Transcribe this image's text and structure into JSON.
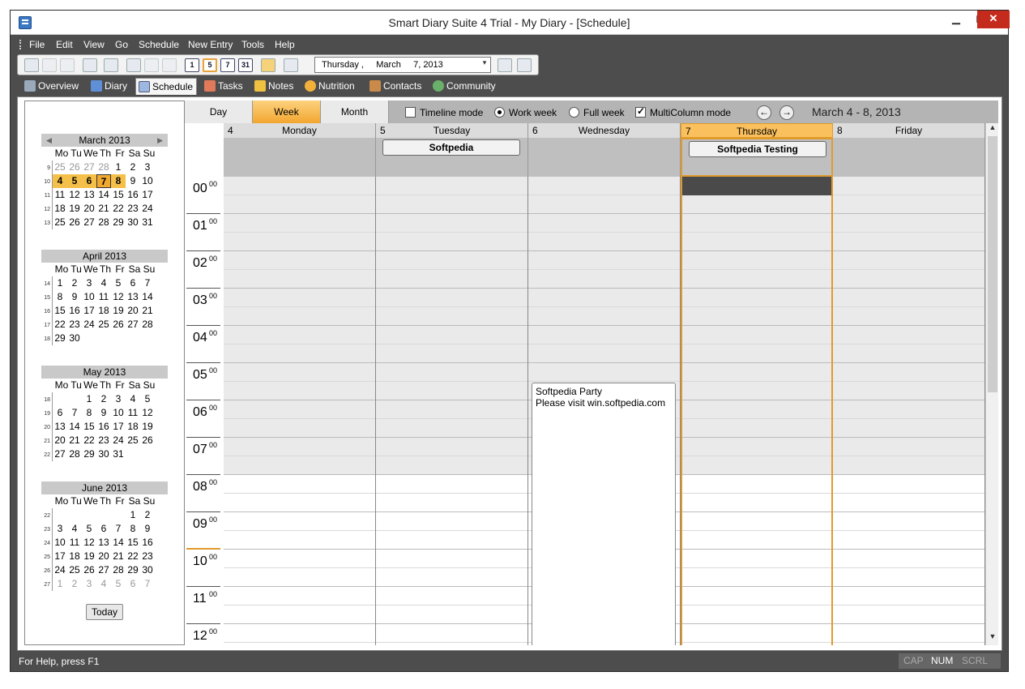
{
  "window": {
    "title": "Smart Diary Suite 4 Trial - My Diary - [Schedule]",
    "min": "▁",
    "max": "▢",
    "close": "✕"
  },
  "menu": [
    "File",
    "Edit",
    "View",
    "Go",
    "Schedule",
    "New Entry",
    "Tools",
    "Help"
  ],
  "toolbar": {
    "cal_buttons": [
      "1",
      "5",
      "7",
      "31"
    ],
    "date_text": "Thursday ,     March     7, 2013",
    "date_drop": "▾"
  },
  "tabs": [
    "Overview",
    "Diary",
    "Schedule",
    "Tasks",
    "Notes",
    "Nutrition",
    "Contacts",
    "Community"
  ],
  "mini_calendars": [
    {
      "title": "March 2013",
      "dow": [
        "Mo",
        "Tu",
        "We",
        "Th",
        "Fr",
        "Sa",
        "Su"
      ],
      "weeks": [
        {
          "wk": "9",
          "days": [
            "25",
            "26",
            "27",
            "28",
            "1",
            "2",
            "3"
          ]
        },
        {
          "wk": "10",
          "days": [
            "4",
            "5",
            "6",
            "7",
            "8",
            "9",
            "10"
          ]
        },
        {
          "wk": "11",
          "days": [
            "11",
            "12",
            "13",
            "14",
            "15",
            "16",
            "17"
          ]
        },
        {
          "wk": "12",
          "days": [
            "18",
            "19",
            "20",
            "21",
            "22",
            "23",
            "24"
          ]
        },
        {
          "wk": "13",
          "days": [
            "25",
            "26",
            "27",
            "28",
            "29",
            "30",
            "31"
          ]
        }
      ]
    },
    {
      "title": "April 2013",
      "dow": [
        "Mo",
        "Tu",
        "We",
        "Th",
        "Fr",
        "Sa",
        "Su"
      ],
      "weeks": [
        {
          "wk": "14",
          "days": [
            "1",
            "2",
            "3",
            "4",
            "5",
            "6",
            "7"
          ]
        },
        {
          "wk": "15",
          "days": [
            "8",
            "9",
            "10",
            "11",
            "12",
            "13",
            "14"
          ]
        },
        {
          "wk": "16",
          "days": [
            "15",
            "16",
            "17",
            "18",
            "19",
            "20",
            "21"
          ]
        },
        {
          "wk": "17",
          "days": [
            "22",
            "23",
            "24",
            "25",
            "26",
            "27",
            "28"
          ]
        },
        {
          "wk": "18",
          "days": [
            "29",
            "30",
            "",
            "",
            "",
            "",
            ""
          ]
        }
      ]
    },
    {
      "title": "May 2013",
      "dow": [
        "Mo",
        "Tu",
        "We",
        "Th",
        "Fr",
        "Sa",
        "Su"
      ],
      "weeks": [
        {
          "wk": "18",
          "days": [
            "",
            "",
            "1",
            "2",
            "3",
            "4",
            "5"
          ]
        },
        {
          "wk": "19",
          "days": [
            "6",
            "7",
            "8",
            "9",
            "10",
            "11",
            "12"
          ]
        },
        {
          "wk": "20",
          "days": [
            "13",
            "14",
            "15",
            "16",
            "17",
            "18",
            "19"
          ]
        },
        {
          "wk": "21",
          "days": [
            "20",
            "21",
            "22",
            "23",
            "24",
            "25",
            "26"
          ]
        },
        {
          "wk": "22",
          "days": [
            "27",
            "28",
            "29",
            "30",
            "31",
            "",
            ""
          ]
        }
      ]
    },
    {
      "title": "June 2013",
      "dow": [
        "Mo",
        "Tu",
        "We",
        "Th",
        "Fr",
        "Sa",
        "Su"
      ],
      "weeks": [
        {
          "wk": "22",
          "days": [
            "",
            "",
            "",
            "",
            "",
            "1",
            "2"
          ]
        },
        {
          "wk": "23",
          "days": [
            "3",
            "4",
            "5",
            "6",
            "7",
            "8",
            "9"
          ]
        },
        {
          "wk": "24",
          "days": [
            "10",
            "11",
            "12",
            "13",
            "14",
            "15",
            "16"
          ]
        },
        {
          "wk": "25",
          "days": [
            "17",
            "18",
            "19",
            "20",
            "21",
            "22",
            "23"
          ]
        },
        {
          "wk": "26",
          "days": [
            "24",
            "25",
            "26",
            "27",
            "28",
            "29",
            "30"
          ]
        },
        {
          "wk": "27",
          "days": [
            "1",
            "2",
            "3",
            "4",
            "5",
            "6",
            "7"
          ]
        }
      ]
    }
  ],
  "today_label": "Today",
  "views": [
    "Day",
    "Week",
    "Month"
  ],
  "options": {
    "timeline": "Timeline mode",
    "work_week": "Work week",
    "full_week": "Full week",
    "multicolumn": "MultiColumn mode"
  },
  "range_text": "March 4 - 8, 2013",
  "nav": {
    "prev": "←",
    "next": "→"
  },
  "days": [
    {
      "num": "4",
      "name": "Monday",
      "allday": ""
    },
    {
      "num": "5",
      "name": "Tuesday",
      "allday": "Softpedia"
    },
    {
      "num": "6",
      "name": "Wednesday",
      "allday": ""
    },
    {
      "num": "7",
      "name": "Thursday",
      "allday": "Softpedia Testing"
    },
    {
      "num": "8",
      "name": "Friday",
      "allday": ""
    }
  ],
  "hours": [
    "00",
    "01",
    "02",
    "03",
    "04",
    "05",
    "06",
    "07",
    "08",
    "09",
    "10",
    "11",
    "12"
  ],
  "minute_sup": "00",
  "event": {
    "title": "Softpedia Party",
    "body": "Please visit win.softpedia.com"
  },
  "status": {
    "help": "For Help, press F1",
    "cap": "CAP",
    "num": "NUM",
    "scrl": "SCRL"
  },
  "colors": {
    "accent": "#e09a2c",
    "chrome": "#4d4d4d"
  }
}
